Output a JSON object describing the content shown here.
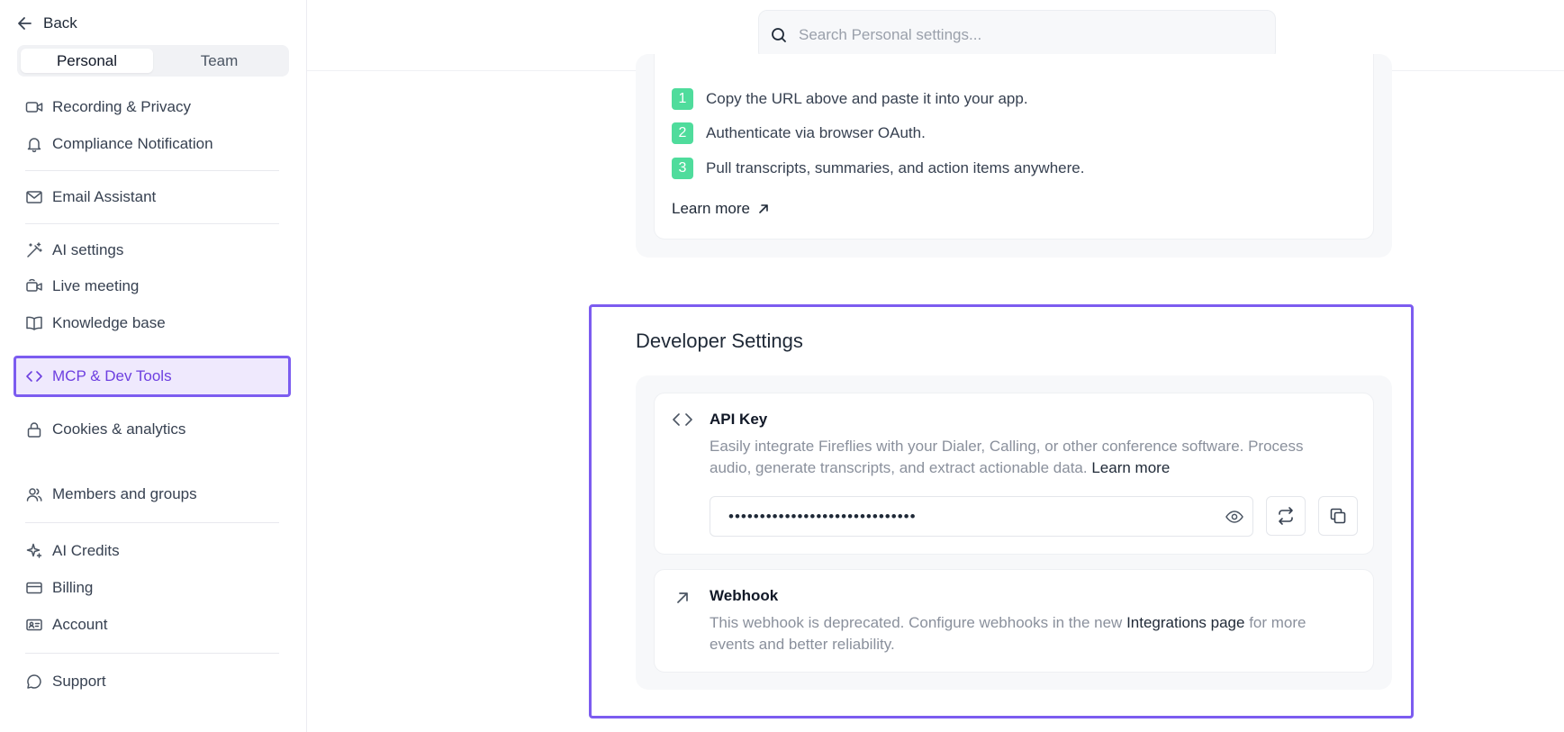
{
  "sidebar": {
    "back_label": "Back",
    "tabs": [
      "Personal",
      "Team"
    ],
    "active_tab": "Personal",
    "items": [
      {
        "label": "Recording & Privacy",
        "icon": "video-icon"
      },
      {
        "label": "Compliance Notification",
        "icon": "bell-icon"
      },
      {
        "label": "Email Assistant",
        "icon": "mail-icon"
      },
      {
        "label": "AI settings",
        "icon": "magic-wand-icon"
      },
      {
        "label": "Live meeting",
        "icon": "live-video-icon"
      },
      {
        "label": "Knowledge base",
        "icon": "book-icon"
      },
      {
        "label": "MCP & Dev Tools",
        "icon": "code-icon"
      },
      {
        "label": "Cookies & analytics",
        "icon": "lock-icon"
      },
      {
        "label": "Members and groups",
        "icon": "users-icon"
      },
      {
        "label": "AI Credits",
        "icon": "sparkle-icon"
      },
      {
        "label": "Billing",
        "icon": "credit-card-icon"
      },
      {
        "label": "Account",
        "icon": "id-card-icon"
      },
      {
        "label": "Support",
        "icon": "chat-icon"
      }
    ],
    "active_item": "MCP & Dev Tools"
  },
  "search": {
    "placeholder": "Search Personal settings..."
  },
  "mcp_steps": {
    "steps": [
      {
        "num": "1",
        "text": "Copy the URL above and paste it into your app."
      },
      {
        "num": "2",
        "text": "Authenticate via browser OAuth."
      },
      {
        "num": "3",
        "text": "Pull transcripts, summaries, and action items anywhere."
      }
    ],
    "learn_more": "Learn more"
  },
  "developer_settings": {
    "title": "Developer Settings",
    "api_key": {
      "title": "API Key",
      "description": "Easily integrate Fireflies with your Dialer, Calling, or other conference software. Process audio, generate transcripts, and extract actionable data.",
      "learn_more": "Learn more",
      "masked_value": "••••••••••••••••••••••••••••••"
    },
    "webhook": {
      "title": "Webhook",
      "description_before": "This webhook is deprecated. Configure webhooks in the new",
      "link": "Integrations page",
      "description_after": "for more events and better reliability."
    }
  },
  "colors": {
    "accent": "#7c5cf0",
    "active_text": "#6d3fe0",
    "step_badge": "#4fdc9c"
  }
}
